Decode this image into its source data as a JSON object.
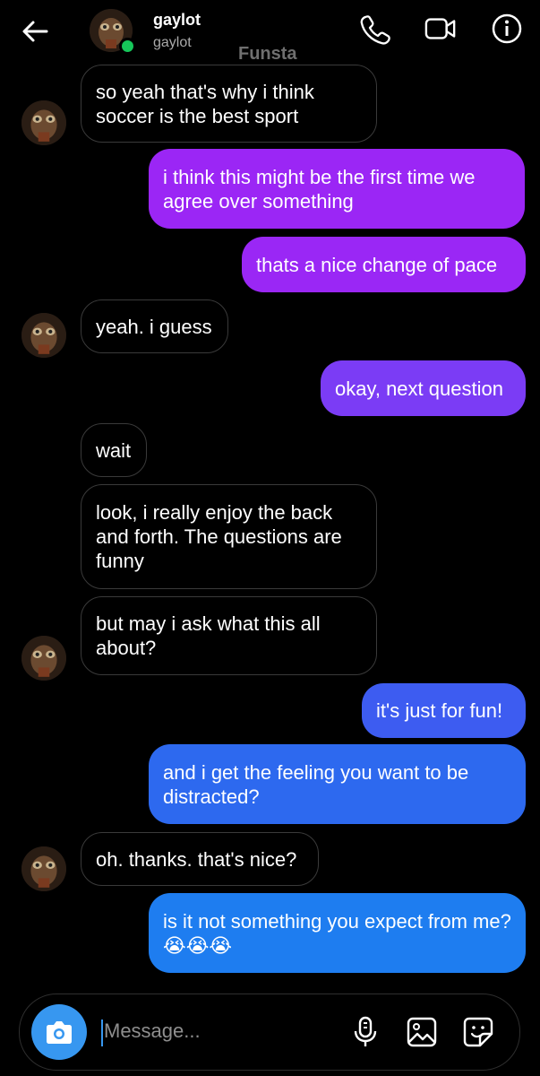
{
  "header": {
    "name": "gaylot",
    "handle": "gaylot",
    "watermark": "Funsta",
    "icons": [
      "back-arrow-icon",
      "phone-icon",
      "video-camera-icon",
      "info-icon"
    ]
  },
  "messages": [
    {
      "side": "in",
      "text": "so yeah that's why i think soccer is the best sport"
    },
    {
      "side": "out",
      "text": "i think this might be the first time we agree over something"
    },
    {
      "side": "out",
      "text": "thats a nice change of pace"
    },
    {
      "side": "in",
      "text": "yeah. i guess"
    },
    {
      "side": "out",
      "text": "okay, next question"
    },
    {
      "side": "in",
      "text": "wait"
    },
    {
      "side": "in",
      "text": "look, i really enjoy the back and forth. The questions are funny"
    },
    {
      "side": "in",
      "text": "but may i ask what this all about?"
    },
    {
      "side": "out",
      "text": "it's just for fun!"
    },
    {
      "side": "out",
      "text": "and i get the feeling you want to be distracted?"
    },
    {
      "side": "in",
      "text": "oh. thanks. that's nice?"
    },
    {
      "side": "out",
      "text": "is it not something you expect from me? 😭😭😭"
    }
  ],
  "composer": {
    "placeholder": "Message...",
    "icons": [
      "camera-icon",
      "microphone-icon",
      "gallery-icon",
      "sticker-icon"
    ]
  },
  "colors": {
    "background": "#000000",
    "outgoing_top": "#9b26f5",
    "outgoing_mid": "#5a4cf5",
    "outgoing_bottom": "#1e7df0",
    "incoming_border": "#3a3a3a",
    "accent": "#3797f0",
    "online": "#16c75a"
  }
}
